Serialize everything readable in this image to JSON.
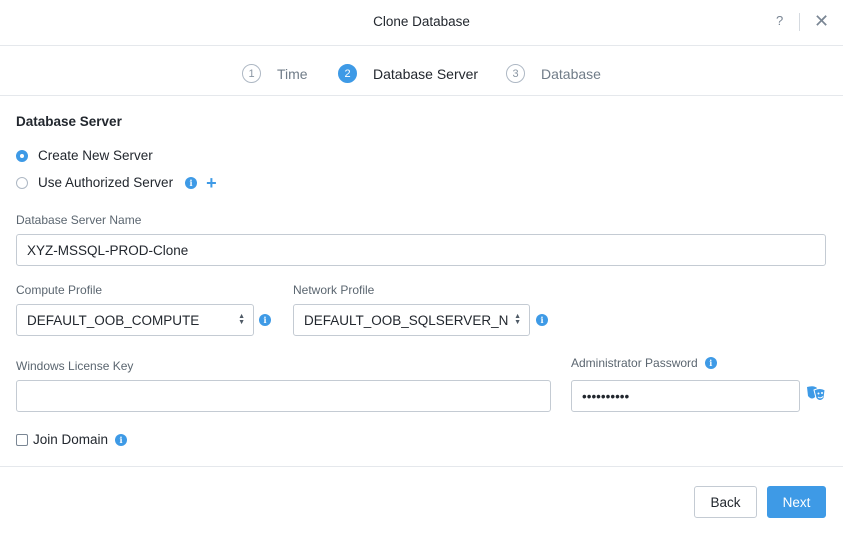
{
  "header": {
    "title": "Clone Database",
    "help_label": "?",
    "close_label": "✕"
  },
  "stepper": {
    "steps": [
      {
        "number": "1",
        "label": "Time",
        "active": false
      },
      {
        "number": "2",
        "label": "Database Server",
        "active": true
      },
      {
        "number": "3",
        "label": "Database",
        "active": false
      }
    ]
  },
  "form": {
    "section_title": "Database Server",
    "server_options": [
      {
        "label": "Create New Server",
        "selected": true
      },
      {
        "label": "Use Authorized Server",
        "selected": false
      }
    ],
    "info_glyph": "i",
    "add_glyph": "+",
    "server_name": {
      "label": "Database Server Name",
      "value": "XYZ-MSSQL-PROD-Clone"
    },
    "compute_profile": {
      "label": "Compute Profile",
      "value": "DEFAULT_OOB_COMPUTE"
    },
    "network_profile": {
      "label": "Network Profile",
      "value": "DEFAULT_OOB_SQLSERVER_N"
    },
    "license_key": {
      "label": "Windows License Key",
      "value": ""
    },
    "admin_password": {
      "label": "Administrator Password",
      "value": "••••••••••"
    },
    "join_domain": {
      "label": "Join Domain",
      "checked": false
    }
  },
  "footer": {
    "back_label": "Back",
    "next_label": "Next"
  },
  "colors": {
    "accent": "#3e9ae6",
    "border": "#c4cbd3",
    "text": "#22272e"
  }
}
